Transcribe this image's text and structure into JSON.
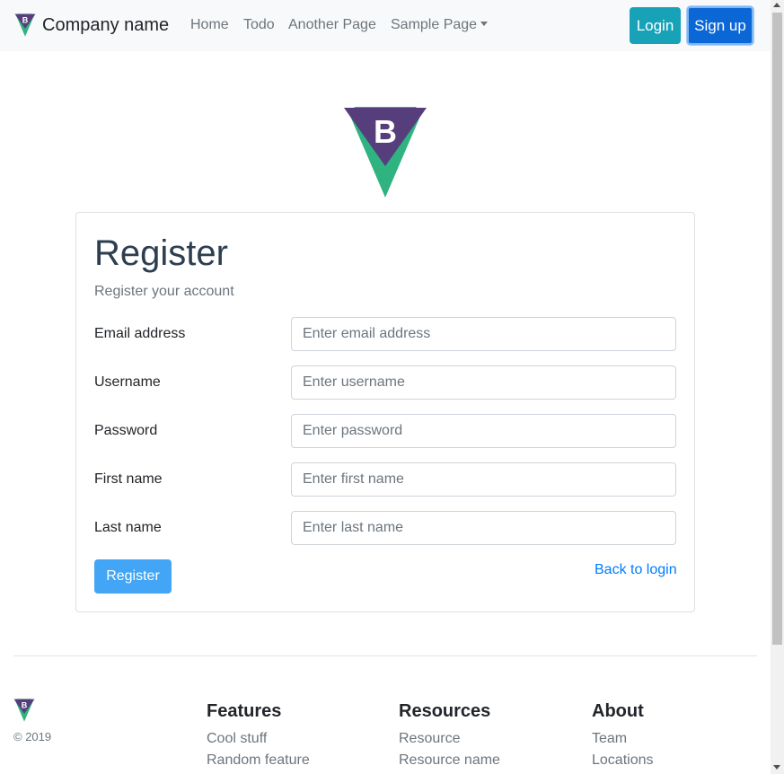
{
  "navbar": {
    "brand": "Company name",
    "links": [
      "Home",
      "Todo",
      "Another Page",
      "Sample Page"
    ],
    "login_label": "Login",
    "signup_label": "Sign up"
  },
  "register": {
    "title": "Register",
    "subtitle": "Register your account",
    "fields": [
      {
        "label": "Email address",
        "placeholder": "Enter email address"
      },
      {
        "label": "Username",
        "placeholder": "Enter username"
      },
      {
        "label": "Password",
        "placeholder": "Enter password"
      },
      {
        "label": "First name",
        "placeholder": "Enter first name"
      },
      {
        "label": "Last name",
        "placeholder": "Enter last name"
      }
    ],
    "submit_label": "Register",
    "back_link": "Back to login"
  },
  "footer": {
    "copyright": "© 2019",
    "columns": [
      {
        "heading": "Features",
        "links": [
          "Cool stuff",
          "Random feature"
        ]
      },
      {
        "heading": "Resources",
        "links": [
          "Resource",
          "Resource name"
        ]
      },
      {
        "heading": "About",
        "links": [
          "Team",
          "Locations"
        ]
      }
    ]
  },
  "colors": {
    "logo_purple": "#563d7c",
    "logo_green": "#2fb380",
    "login_button": "#17a2b8",
    "signup_button": "#0b67d6",
    "register_button": "#42a5f5",
    "link": "#007bff"
  }
}
